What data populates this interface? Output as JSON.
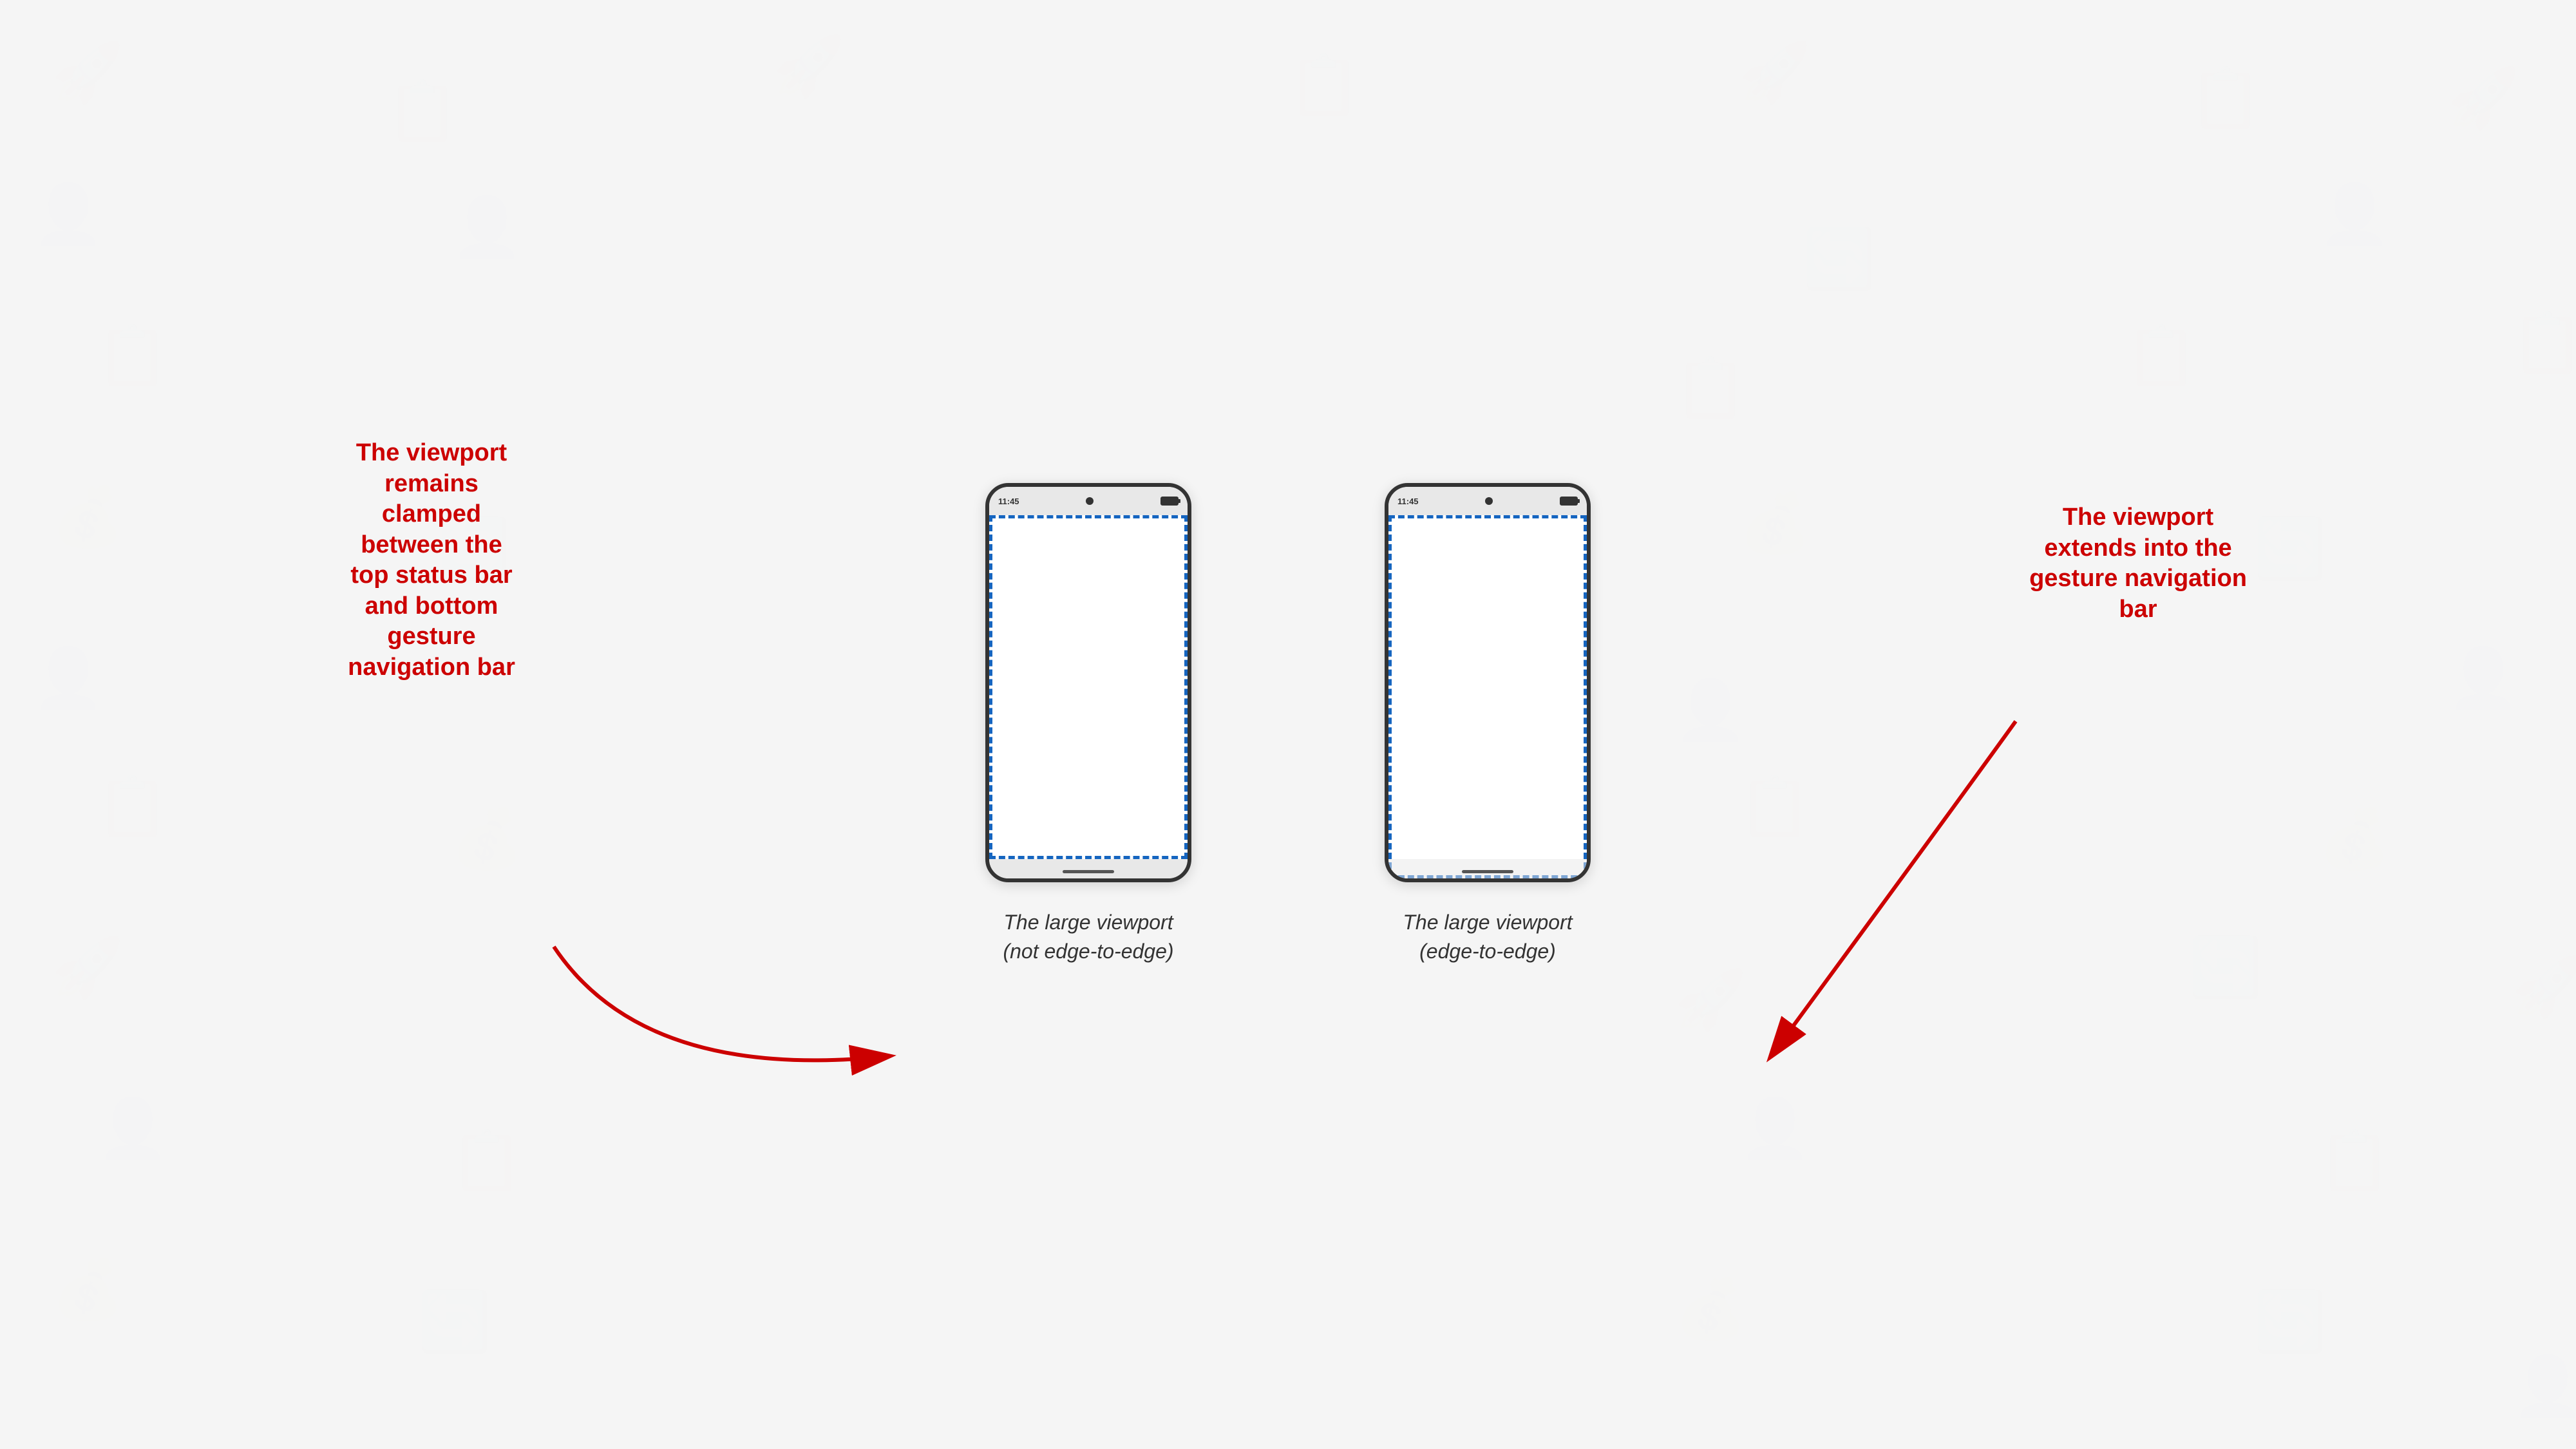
{
  "background": {
    "color": "#f5f5f5"
  },
  "phones": [
    {
      "id": "not-edge",
      "status_time": "11:45",
      "caption_line1": "The large viewport",
      "caption_line2": "(not edge-to-edge)",
      "viewport_type": "not-edge"
    },
    {
      "id": "edge",
      "status_time": "11:45",
      "caption_line1": "The large viewport",
      "caption_line2": "(edge-to-edge)",
      "viewport_type": "edge"
    }
  ],
  "annotations": {
    "left": {
      "line1": "The viewport",
      "line2": "remains",
      "line3": "clamped",
      "line4": "between the",
      "line5": "top status bar",
      "line6": "and bottom",
      "line7": "gesture",
      "line8": "navigation bar"
    },
    "right": {
      "line1": "The viewport",
      "line2": "extends into the",
      "line3": "gesture navigation",
      "line4": "bar"
    }
  }
}
